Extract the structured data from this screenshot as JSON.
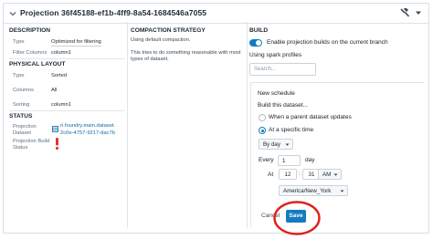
{
  "header": {
    "title": "Projection 36f45188-ef1b-4ff9-8a54-1684546a7055"
  },
  "description": {
    "title": "DESCRIPTION",
    "type_label": "Type",
    "type_value": "Optimized for filtering",
    "filter_label": "Filter Columns",
    "filter_value": "column1"
  },
  "physical_layout": {
    "title": "PHYSICAL LAYOUT",
    "type_label": "Type",
    "type_value": "Sorted",
    "columns_label": "Columns",
    "columns_value": "All",
    "sorting_label": "Sorting",
    "sorting_value": "column1"
  },
  "status": {
    "title": "STATUS",
    "dataset_label_1": "Projection",
    "dataset_label_2": "Dataset",
    "dataset_link_1": "ri.foundry.main.dataset.",
    "dataset_link_2": "2c0e-4757-9217-dac7b",
    "build_label_1": "Projection Build",
    "build_label_2": "Status"
  },
  "compaction": {
    "title": "COMPACTION STRATEGY",
    "line1": "Using default compaction.",
    "line2": "This tries to do something reasonable with most",
    "line3": "types of dataset."
  },
  "build": {
    "title": "BUILD",
    "toggle_label": "Enable projection builds on the current branch",
    "toggle_on": true,
    "spark_label": "Using spark profiles",
    "search_placeholder": "Search...",
    "schedule_title": "New schedule",
    "build_this": "Build this dataset...",
    "option_parent": "When a parent dataset updates",
    "option_time": "At a specific time",
    "selected_option": "At a specific time",
    "frequency": "By day",
    "every_label": "Every",
    "every_value": "1",
    "every_unit": "day",
    "at_label": "At",
    "hour": "12",
    "minute": "31",
    "ampm": "AM",
    "timezone": "America/New_York",
    "cancel_label": "Cancel",
    "save_label": "Save"
  },
  "colors": {
    "accent": "#137cbd",
    "link": "#106ba3",
    "error": "#db3737",
    "annotation": "#e0201b"
  },
  "icons": [
    "chevron-down-icon",
    "hammer-icon",
    "caret-down-icon",
    "dataset-icon",
    "exclamation-icon"
  ]
}
